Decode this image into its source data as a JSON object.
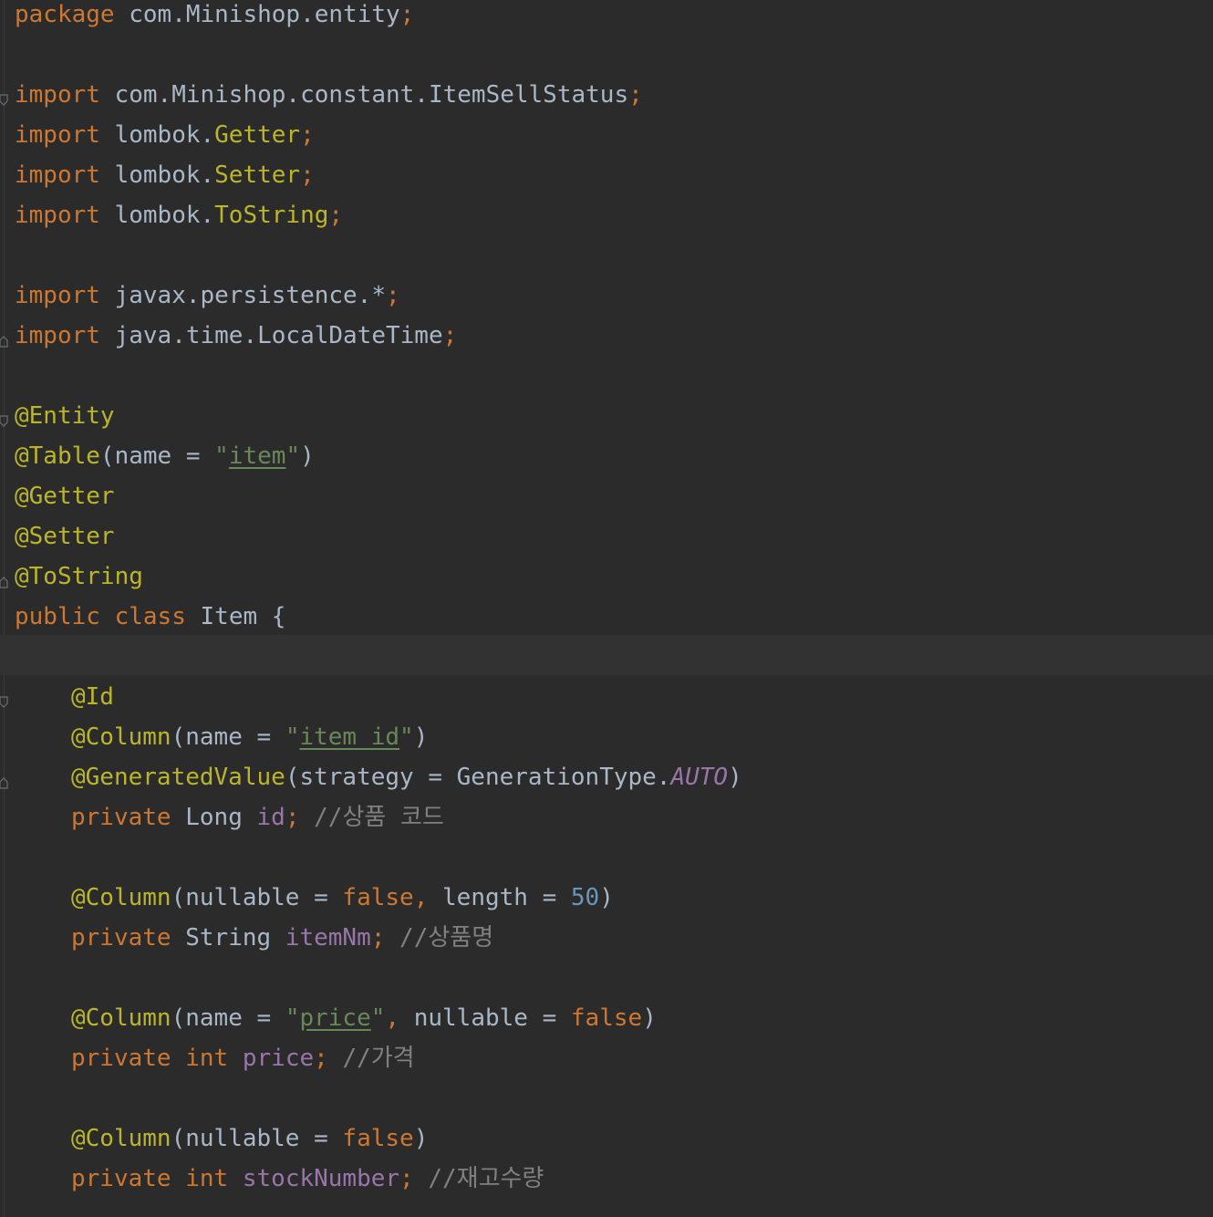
{
  "code": {
    "package_kw": "package",
    "package_name": "com.Minishop.entity",
    "import_kw": "import",
    "imports": [
      {
        "pkg": "com.Minishop.constant.ItemSellStatus",
        "cls": ""
      },
      {
        "pkg": "lombok.",
        "cls": "Getter"
      },
      {
        "pkg": "lombok.",
        "cls": "Setter"
      },
      {
        "pkg": "lombok.",
        "cls": "ToString"
      },
      {
        "pkg": "javax.persistence.*",
        "cls": ""
      },
      {
        "pkg": "java.time.LocalDateTime",
        "cls": ""
      }
    ],
    "annotations": {
      "entity": "@Entity",
      "table": "@Table",
      "getter": "@Getter",
      "setter": "@Setter",
      "tostring": "@ToString",
      "id": "@Id",
      "column": "@Column",
      "generated": "@GeneratedValue"
    },
    "table_arg": "name = ",
    "table_name": "item",
    "class_decl": {
      "public": "public",
      "class": "class",
      "name": "Item {"
    },
    "fields": {
      "id_col_name": "item_id",
      "strategy_arg": "strategy = GenerationType.",
      "strategy_val": "AUTO",
      "private": "private",
      "long_type": "Long ",
      "id_name": "id",
      "id_comment": "//상품 코드",
      "nullable_arg": "nullable = ",
      "false_kw": "false",
      "length_arg": "length = ",
      "length_val": "50",
      "string_type": "String ",
      "itemnm_name": "itemNm",
      "itemnm_comment": "//상품명",
      "price_col_name": "price",
      "int_kw": "int",
      "price_name": "price",
      "price_comment": "//가격",
      "stock_name": "stockNumber",
      "stock_comment": "//재고수량"
    }
  }
}
